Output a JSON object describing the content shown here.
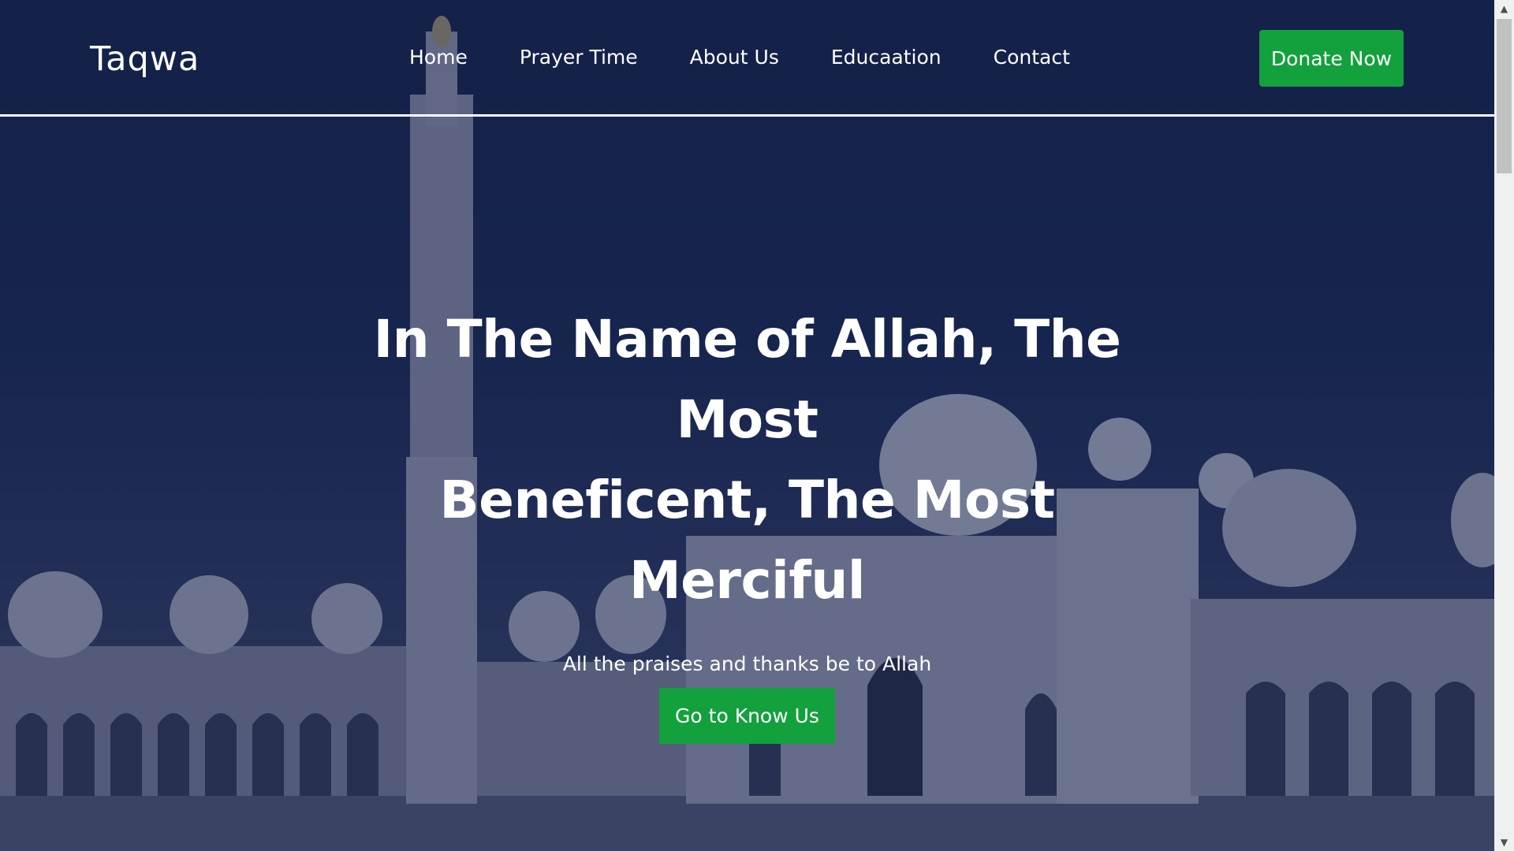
{
  "navbar": {
    "brand": "Taqwa",
    "links": [
      "Home",
      "Prayer Time",
      "About Us",
      "Educaation",
      "Contact"
    ],
    "donate_label": "Donate Now"
  },
  "hero": {
    "title_line1": "In The Name of Allah, The Most",
    "title_line2": "Beneficent, The Most Merciful",
    "subtitle": "All the praises and thanks be to Allah",
    "cta_label": "Go to Know Us",
    "background_image": "mosque-photo"
  },
  "colors": {
    "navy": "#16234a",
    "accent_green": "#12a13c",
    "text": "#ffffff"
  },
  "scrollbar": {
    "up_icon": "triangle-up-icon",
    "down_icon": "triangle-down-icon"
  }
}
